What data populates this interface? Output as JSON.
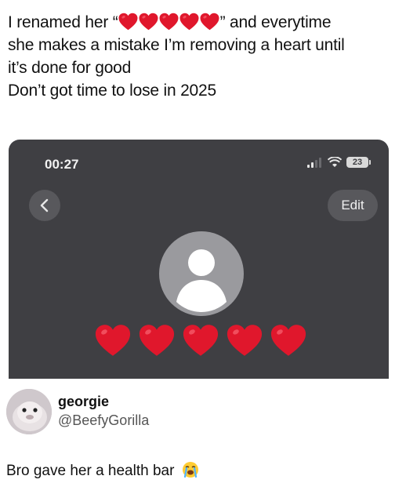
{
  "post": {
    "line1_before": "I renamed her “",
    "line1_after": "” and everytime",
    "line2": "she makes a mistake I’m removing a heart until",
    "line3": "it’s done for good",
    "line4": "Don’t got time to lose in 2025",
    "inline_hearts": 5
  },
  "phone": {
    "time": "00:27",
    "battery": "23",
    "edit_label": "Edit",
    "contact_name_hearts": 5,
    "heart_color": "#e0172c",
    "background_color": "#3f3f43"
  },
  "author": {
    "name": "georgie",
    "handle": "@BeefyGorilla"
  },
  "reply": {
    "text": "Bro gave her a health bar",
    "emoji": "loudly-crying-face-icon"
  }
}
